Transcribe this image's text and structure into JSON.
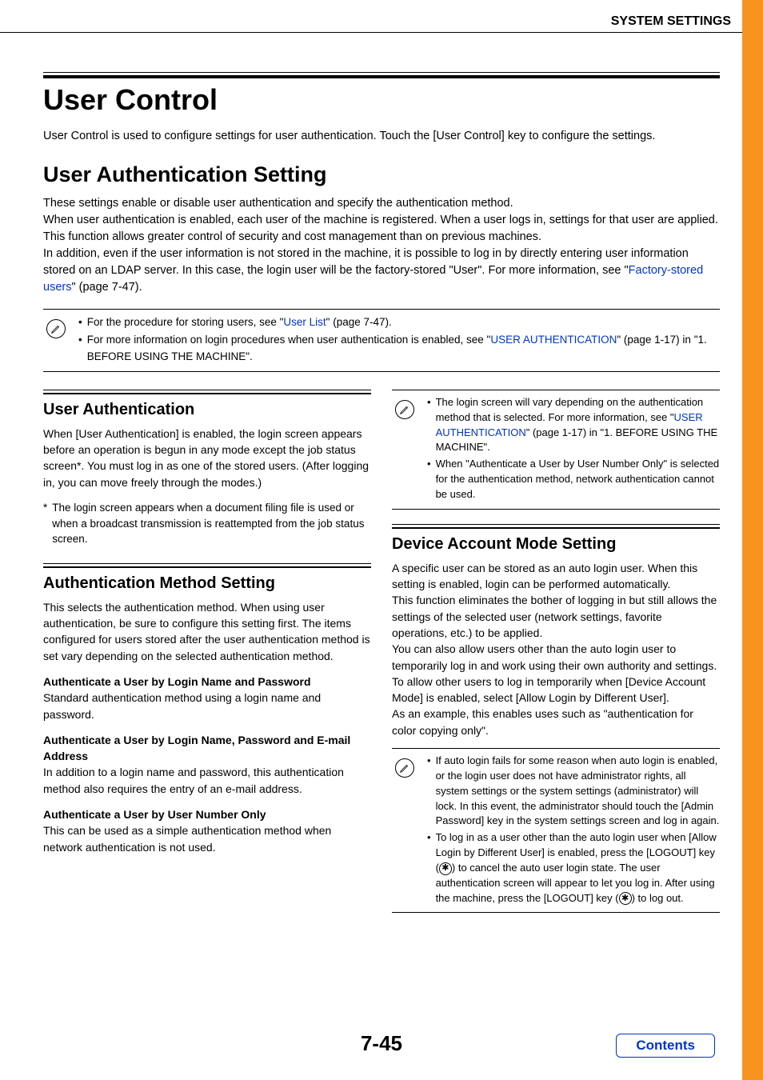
{
  "header": {
    "section": "SYSTEM SETTINGS"
  },
  "title": "User Control",
  "intro": "User Control is used to configure settings for user authentication. Touch the [User Control] key to configure the settings.",
  "h2": "User Authentication Setting",
  "p1a": "These settings enable or disable user authentication and specify the authentication method.",
  "p1b": "When user authentication is enabled, each user of the machine is registered. When a user logs in, settings for that user are applied. This function allows greater control of security and cost management than on previous machines.",
  "p1c_pre": "In addition, even if the user information is not stored in the machine, it is possible to log in by directly entering user information stored on an LDAP server. In this case, the login user will be the factory-stored \"User\". For more information, see \"",
  "p1c_link": "Factory-stored users",
  "p1c_post": "\" (page 7-47).",
  "note1": {
    "b1_pre": "For the procedure for storing users, see \"",
    "b1_link": "User List",
    "b1_post": "\" (page 7-47).",
    "b2_pre": "For more information on login procedures when user authentication is enabled, see \"",
    "b2_link": "USER AUTHENTICATION",
    "b2_post": "\" (page 1-17) in \"1. BEFORE USING THE MACHINE\"."
  },
  "left": {
    "s1_title": "User Authentication",
    "s1_body": "When [User Authentication] is enabled, the login screen appears before an operation is begun in any mode except the job status screen*. You must log in as one of the stored users. (After logging in, you can move freely through the modes.)",
    "s1_foot_mark": "*",
    "s1_foot": "The login screen appears when a document filing file is used or when a broadcast transmission is reattempted from the job status screen.",
    "s2_title": "Authentication Method Setting",
    "s2_body": "This selects the authentication method. When using user authentication, be sure to configure this setting first. The items configured for users stored after the user authentication method is set vary depending on the selected authentication method.",
    "m1_t": "Authenticate a User by Login Name and Password",
    "m1_b": "Standard authentication method using a login name and password.",
    "m2_t": "Authenticate a User by Login Name, Password and E-mail Address",
    "m2_b": "In addition to a login name and password, this authentication method also requires the entry of an e-mail address.",
    "m3_t": "Authenticate a User by User Number Only",
    "m3_b": "This can be used as a simple authentication method when network authentication is not used."
  },
  "right": {
    "note2": {
      "b1_pre": "The login screen will vary depending on the authentication method that is selected. For more information, see \"",
      "b1_link": "USER AUTHENTICATION",
      "b1_post": "\" (page 1-17) in \"1. BEFORE USING THE MACHINE\".",
      "b2": "When \"Authenticate a User by User Number Only\" is selected for the authentication method, network authentication cannot be used."
    },
    "s3_title": "Device Account Mode Setting",
    "s3_p1": "A specific user can be stored as an auto login user. When this setting is enabled, login can be performed automatically.",
    "s3_p2": "This function eliminates the bother of logging in but still allows the settings of the selected user (network settings, favorite operations, etc.) to be applied.",
    "s3_p3": "You can also allow users other than the auto login user to temporarily log in and work using their own authority and settings. To allow other users to log in temporarily when [Device Account Mode] is enabled, select [Allow Login by Different User].",
    "s3_p4": "As an example, this enables uses such as \"authentication for color copying only\".",
    "note3": {
      "b1": "If auto login fails for some reason when auto login is enabled, or the login user does not have administrator rights, all system settings or the system settings (administrator) will lock. In this event, the administrator should touch the [Admin Password] key in the system settings screen and log in again.",
      "b2_pre": "To log in as a user other than the auto login user when [Allow Login by Different User] is enabled, press the [LOGOUT] key (",
      "b2_mid": ") to cancel the auto user login state. The user authentication screen will appear to let you log in. After using the machine, press the [LOGOUT] key (",
      "b2_post": ") to log out."
    }
  },
  "pagenum": "7-45",
  "contents": "Contents",
  "star": "✱"
}
